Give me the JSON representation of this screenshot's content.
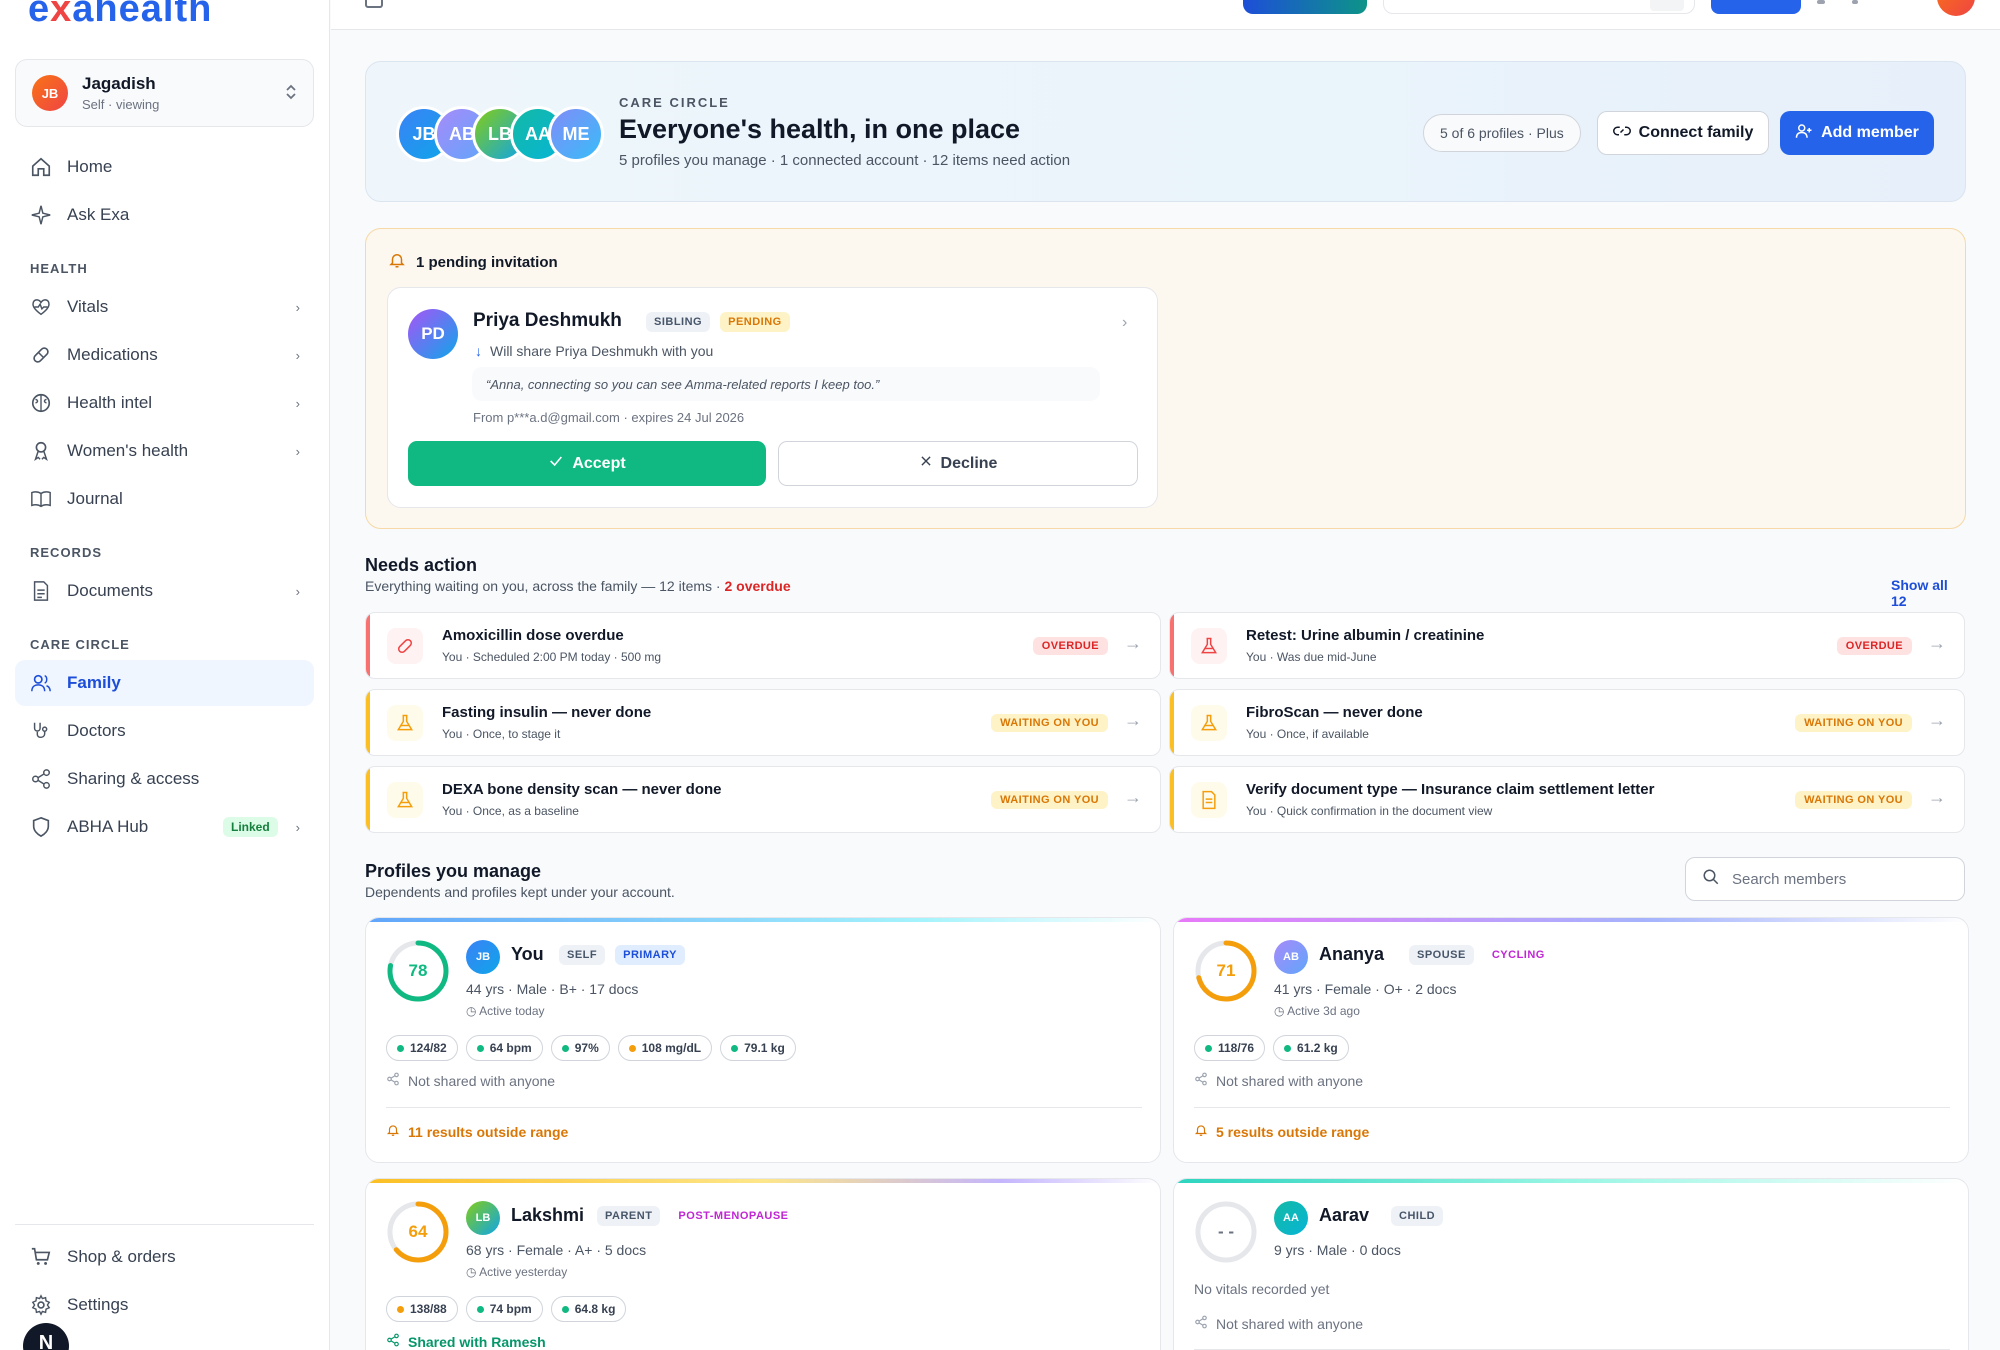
{
  "app": {
    "logo": "exahealth"
  },
  "profile": {
    "initials": "JB",
    "name": "Jagadish",
    "sub": "Self · viewing"
  },
  "nav": {
    "home": "Home",
    "ask": "Ask Exa",
    "health_section": "HEALTH",
    "vitals": "Vitals",
    "medications": "Medications",
    "health_intel": "Health intel",
    "womens_health": "Women's health",
    "journal": "Journal",
    "records_section": "RECORDS",
    "documents": "Documents",
    "care_section": "CARE CIRCLE",
    "family": "Family",
    "doctors": "Doctors",
    "sharing": "Sharing & access",
    "abha": "ABHA Hub",
    "abha_badge": "Linked",
    "shop": "Shop & orders",
    "settings": "Settings",
    "help_initial": "N"
  },
  "hero": {
    "avatars": [
      "JB",
      "AB",
      "LB",
      "AA",
      "ME"
    ],
    "eyebrow": "CARE CIRCLE",
    "title": "Everyone's health, in one place",
    "subtitle": "5 profiles you manage · 1 connected account · 12 items need action",
    "plan_pill": "5 of 6 profiles · Plus",
    "connect_label": "Connect family",
    "add_label": "Add member"
  },
  "invitation": {
    "header": "1 pending invitation",
    "initials": "PD",
    "name": "Priya Deshmukh",
    "relation": "SIBLING",
    "status": "PENDING",
    "share_note": "Will share Priya Deshmukh with you",
    "quote": "“Anna, connecting so you can see Amma-related reports I keep too.”",
    "from": "From p***a.d@gmail.com · expires 24 Jul 2026",
    "accept": "Accept",
    "decline": "Decline"
  },
  "needs_action": {
    "title": "Needs action",
    "subtitle": "Everything waiting on you, across the family — 12 items · ",
    "overdue": "2 overdue",
    "show_all": "Show all 12",
    "items": [
      {
        "title": "Amoxicillin dose overdue",
        "sub": "You · Scheduled 2:00 PM today · 500 mg",
        "status": "OVERDUE",
        "icon": "pill-icon"
      },
      {
        "title": "Retest: Urine albumin / creatinine",
        "sub": "You · Was due mid-June",
        "status": "OVERDUE",
        "icon": "flask-icon"
      },
      {
        "title": "Fasting insulin — never done",
        "sub": "You · Once, to stage it",
        "status": "WAITING ON YOU",
        "icon": "flask-icon"
      },
      {
        "title": "FibroScan — never done",
        "sub": "You · Once, if available",
        "status": "WAITING ON YOU",
        "icon": "flask-icon"
      },
      {
        "title": "DEXA bone density scan — never done",
        "sub": "You · Once, as a baseline",
        "status": "WAITING ON YOU",
        "icon": "flask-icon"
      },
      {
        "title": "Verify document type — Insurance claim settlement letter",
        "sub": "You · Quick confirmation in the document view",
        "status": "WAITING ON YOU",
        "icon": "document-icon"
      }
    ]
  },
  "profiles": {
    "title": "Profiles you manage",
    "subtitle": "Dependents and profiles kept under your account.",
    "search_placeholder": "Search members",
    "cards": [
      {
        "score": "78",
        "score_value": 78,
        "initials": "JB",
        "name": "You",
        "tag1": "SELF",
        "tag2": "PRIMARY",
        "meta": "44 yrs · Male · B+ · 17 docs",
        "active": "Active today",
        "chips": [
          "124/82",
          "64 bpm",
          "97%",
          "108 mg/dL",
          "79.1 kg"
        ],
        "share": "Not shared with anyone",
        "alert": "11 results outside range"
      },
      {
        "score": "71",
        "score_value": 71,
        "initials": "AB",
        "name": "Ananya",
        "tag1": "SPOUSE",
        "tag2": "CYCLING",
        "meta": "41 yrs · Female · O+ · 2 docs",
        "active": "Active 3d ago",
        "chips": [
          "118/76",
          "61.2 kg"
        ],
        "share": "Not shared with anyone",
        "alert": "5 results outside range"
      },
      {
        "score": "64",
        "score_value": 64,
        "initials": "LB",
        "name": "Lakshmi",
        "tag1": "PARENT",
        "tag2": "POST-MENOPAUSE",
        "meta": "68 yrs · Female · A+ · 5 docs",
        "active": "Active yesterday",
        "chips": [
          "138/88",
          "74 bpm",
          "64.8 kg"
        ],
        "share": "Shared with Ramesh"
      },
      {
        "score": "- -",
        "initials": "AA",
        "name": "Aarav",
        "tag1": "CHILD",
        "meta": "9 yrs · Male · 0 docs",
        "novitals": "No vitals recorded yet",
        "share": "Not shared with anyone"
      }
    ]
  }
}
